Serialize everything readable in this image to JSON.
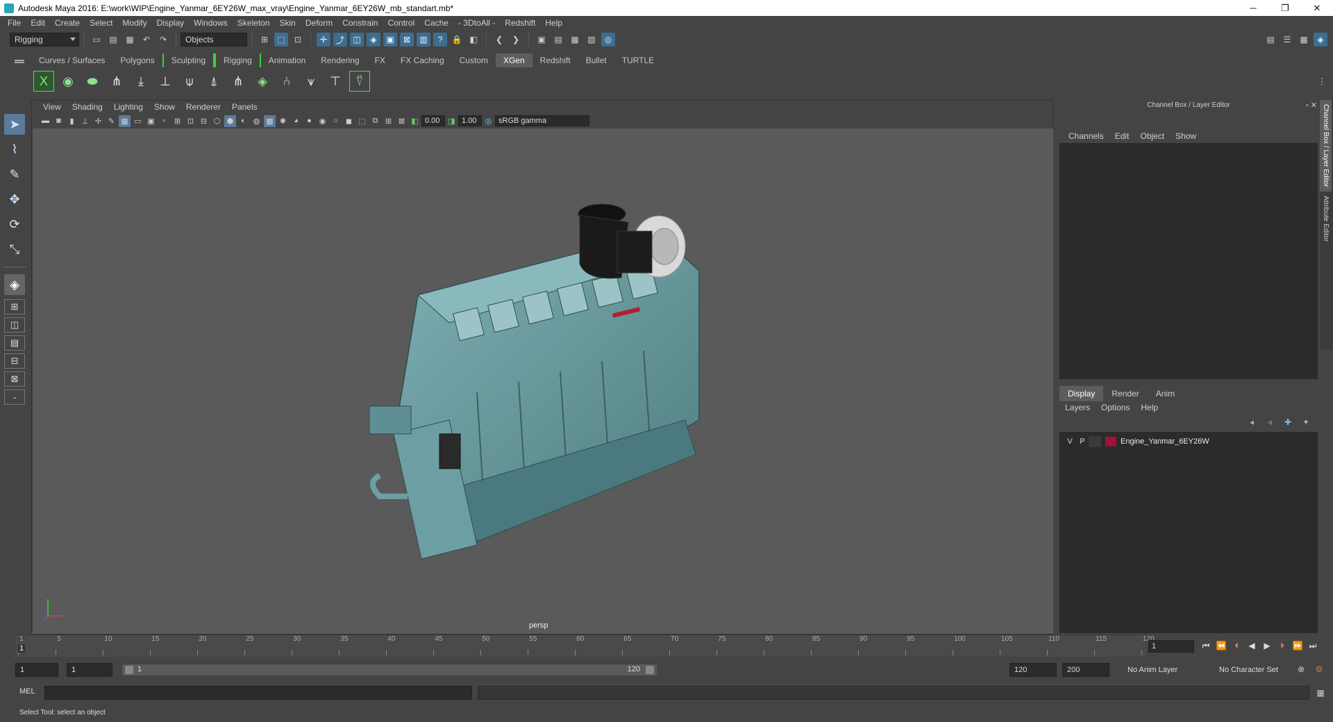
{
  "window": {
    "title": "Autodesk Maya 2016: E:\\work\\WIP\\Engine_Yanmar_6EY26W_max_vray\\Engine_Yanmar_6EY26W_mb_standart.mb*",
    "minimize": "─",
    "restore": "❐",
    "close": "✕"
  },
  "menubar": [
    "File",
    "Edit",
    "Create",
    "Select",
    "Modify",
    "Display",
    "Windows",
    "Skeleton",
    "Skin",
    "Deform",
    "Constrain",
    "Control",
    "Cache",
    "- 3DtoAll -",
    "Redshift",
    "Help"
  ],
  "statusline": {
    "menu_set": "Rigging",
    "selection_mode": "Objects"
  },
  "shelf": {
    "tabs": [
      "Curves / Surfaces",
      "Polygons",
      "Sculpting",
      "Rigging",
      "Animation",
      "Rendering",
      "FX",
      "FX Caching",
      "Custom",
      "XGen",
      "Redshift",
      "Bullet",
      "TURTLE"
    ],
    "active_tab": "XGen"
  },
  "viewport": {
    "menu": [
      "View",
      "Shading",
      "Lighting",
      "Show",
      "Renderer",
      "Panels"
    ],
    "exposure": "0.00",
    "gamma": "1.00",
    "color_space": "sRGB gamma",
    "camera_label": "persp"
  },
  "channel_box": {
    "title": "Channel Box / Layer Editor",
    "menu": [
      "Channels",
      "Edit",
      "Object",
      "Show"
    ],
    "layer_tabs": [
      "Display",
      "Render",
      "Anim"
    ],
    "active_layer_tab": "Display",
    "layer_menu": [
      "Layers",
      "Options",
      "Help"
    ],
    "layers": [
      {
        "v": "V",
        "p": "P",
        "name": "Engine_Yanmar_6EY26W",
        "color": "#a0123a"
      }
    ]
  },
  "side_tabs": [
    "Channel Box / Layer Editor",
    "Attribute Editor"
  ],
  "time_slider": {
    "ticks": [
      "1",
      "5",
      "10",
      "15",
      "20",
      "25",
      "30",
      "35",
      "40",
      "45",
      "50",
      "55",
      "60",
      "65",
      "70",
      "75",
      "80",
      "85",
      "90",
      "95",
      "100",
      "105",
      "110",
      "115",
      "120"
    ],
    "current_frame": "1",
    "frame_field": "1"
  },
  "range_slider": {
    "start_field": "1",
    "start_field2": "1",
    "range_start": "1",
    "range_end": "120",
    "end_field": "120",
    "end_field2": "200",
    "anim_layer": "No Anim Layer",
    "character_set": "No Character Set"
  },
  "command_line": {
    "label": "MEL"
  },
  "help_line": "Select Tool: select an object",
  "colors": {
    "accent_blue": "#5b7b9c",
    "layer_color": "#a0123a",
    "engine": "#5f8f94"
  }
}
